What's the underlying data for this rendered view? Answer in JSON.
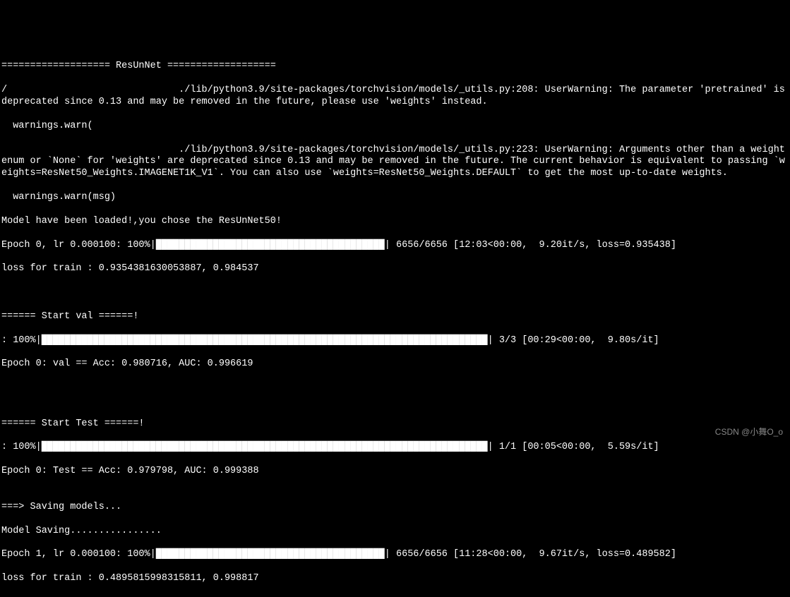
{
  "terminal": {
    "lines": [
      "=================== ResUnNet ===================",
      "/                              ./lib/python3.9/site-packages/torchvision/models/_utils.py:208: UserWarning: The parameter 'pretrained' is deprecated since 0.13 and may be removed in the future, please use 'weights' instead.",
      "  warnings.warn(",
      "                               ./lib/python3.9/site-packages/torchvision/models/_utils.py:223: UserWarning: Arguments other than a weight enum or `None` for 'weights' are deprecated since 0.13 and may be removed in the future. The current behavior is equivalent to passing `weights=ResNet50_Weights.IMAGENET1K_V1`. You can also use `weights=ResNet50_Weights.DEFAULT` to get the most up-to-date weights.",
      "  warnings.warn(msg)",
      "Model have been loaded!,you chose the ResUnNet50!",
      "Epoch 0, lr 0.000100: 100%|████████████████████████████████████████| 6656/6656 [12:03<00:00,  9.20it/s, loss=0.935438]",
      "loss for train : 0.9354381630053887, 0.984537",
      "",
      "",
      "====== Start val ======!",
      ": 100%|██████████████████████████████████████████████████████████████████████████████| 3/3 [00:29<00:00,  9.80s/it]",
      "Epoch 0: val == Acc: 0.980716, AUC: 0.996619",
      "",
      "",
      "",
      "====== Start Test ======!",
      ": 100%|██████████████████████████████████████████████████████████████████████████████| 1/1 [00:05<00:00,  5.59s/it]",
      "Epoch 0: Test == Acc: 0.979798, AUC: 0.999388",
      "",
      "===> Saving models...",
      "Model Saving................",
      "Epoch 1, lr 0.000100: 100%|████████████████████████████████████████| 6656/6656 [11:28<00:00,  9.67it/s, loss=0.489582]",
      "loss for train : 0.4895815998315811, 0.998817"
    ]
  },
  "watermark": {
    "text": "CSDN @小舞O_o"
  }
}
